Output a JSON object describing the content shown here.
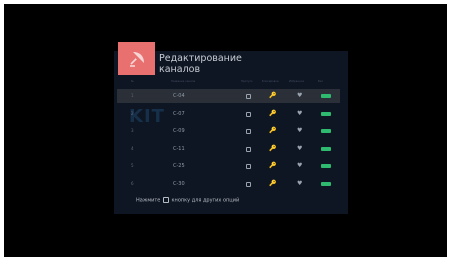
{
  "dialog": {
    "title_line1": "Редактирование",
    "title_line2": "каналов",
    "icon": "satellite-dish-icon",
    "accent_color": "#e8706f",
    "headers": [
      "№",
      "Название канала",
      "Пропуск",
      "Блокировка",
      "Избранное",
      "Вкл"
    ]
  },
  "channels": [
    {
      "num": "1",
      "name": "C-04",
      "selected": true
    },
    {
      "num": "2",
      "name": "C-07",
      "selected": false
    },
    {
      "num": "3",
      "name": "C-09",
      "selected": false
    },
    {
      "num": "4",
      "name": "C-11",
      "selected": false
    },
    {
      "num": "5",
      "name": "C-25",
      "selected": false
    },
    {
      "num": "6",
      "name": "C-30",
      "selected": false
    }
  ],
  "row_icons": [
    "skip-checkbox-icon",
    "lock-icon",
    "heart-icon",
    "enabled-toggle-icon"
  ],
  "toggle_color": "#2fbb6f",
  "hint": {
    "before": "Нажмите",
    "after": "кнопку для других опций"
  }
}
